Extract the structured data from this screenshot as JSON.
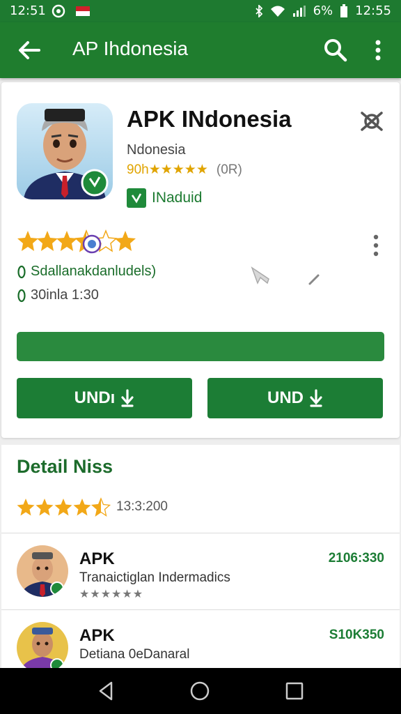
{
  "status_bar": {
    "time_left": "12:51",
    "time_right": "12:55",
    "battery": "6%"
  },
  "app_bar": {
    "title": "AP Ihdonesia"
  },
  "app": {
    "name": "APK INdonesia",
    "developer": "Ndonesia",
    "rating_text": "90h★★★★★",
    "rating_count": "(0R)",
    "installed_label": "INaduid",
    "stars_rating": 3.5,
    "meta1": "Sdallanakdanludels)",
    "meta2": "30inla 1:30",
    "progress": 1.0,
    "button1_label": "UNDı",
    "button2_label": "UND"
  },
  "detail": {
    "title": "Detail Niss",
    "stars_rating": 4.5,
    "rating_value": "13:3:200",
    "items": [
      {
        "name": "APK",
        "subtitle": "Tranaictiglan Indermadics",
        "stars": "★★★★★★",
        "value": "2106:330"
      },
      {
        "name": "APK",
        "subtitle": "Detiana 0eDanaral",
        "stars": "",
        "value": "S10K350"
      }
    ]
  },
  "colors": {
    "primary": "#1f7d2e",
    "accent_star": "#f2a818",
    "text_green": "#1c6b2b"
  }
}
